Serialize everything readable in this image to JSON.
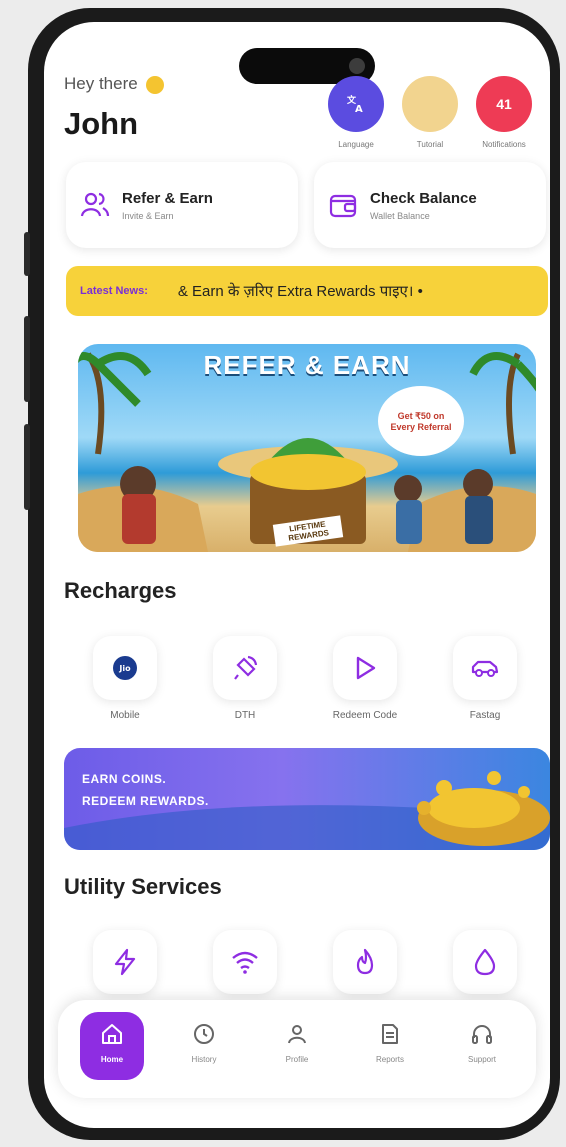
{
  "header": {
    "greeting": "Hey there",
    "user_name": "John",
    "top_actions": [
      {
        "label": "Language",
        "color": "#5b4ce0",
        "value": ""
      },
      {
        "label": "Tutorial",
        "color": "#f2d48f",
        "value": ""
      },
      {
        "label": "Notifications",
        "color": "#ee3b55",
        "value": "41"
      }
    ]
  },
  "quick_cards": [
    {
      "title": "Refer & Earn",
      "subtitle": "Invite & Earn",
      "icon": "users-icon"
    },
    {
      "title": "Check Balance",
      "subtitle": "Wallet Balance",
      "icon": "wallet-icon"
    }
  ],
  "news": {
    "label": "Latest News:",
    "text": "& Earn के ज़रिए Extra Rewards पाइए। •"
  },
  "banner": {
    "title": "REFER & EARN",
    "bubble": "Get ₹50 on Every Referral",
    "chest_label": "LIFETIME REWARDS"
  },
  "recharges": {
    "title": "Recharges",
    "items": [
      {
        "label": "Mobile",
        "icon": "jio-icon"
      },
      {
        "label": "DTH",
        "icon": "satellite-icon"
      },
      {
        "label": "Redeem Code",
        "icon": "play-icon"
      },
      {
        "label": "Fastag",
        "icon": "car-icon"
      }
    ]
  },
  "coins_banner": {
    "line1": "EARN COINS.",
    "line2": "REDEEM REWARDS."
  },
  "utility": {
    "title": "Utility Services",
    "items": [
      {
        "icon": "bolt-icon"
      },
      {
        "icon": "wifi-icon"
      },
      {
        "icon": "flame-icon"
      },
      {
        "icon": "drop-icon"
      }
    ]
  },
  "bottom_nav": [
    {
      "label": "Home",
      "icon": "home-icon",
      "active": true
    },
    {
      "label": "History",
      "icon": "clock-icon",
      "active": false
    },
    {
      "label": "Profile",
      "icon": "user-icon",
      "active": false
    },
    {
      "label": "Reports",
      "icon": "document-icon",
      "active": false
    },
    {
      "label": "Support",
      "icon": "headphones-icon",
      "active": false
    }
  ],
  "colors": {
    "accent": "#8e2de2",
    "news_bg": "#f7d23a"
  }
}
